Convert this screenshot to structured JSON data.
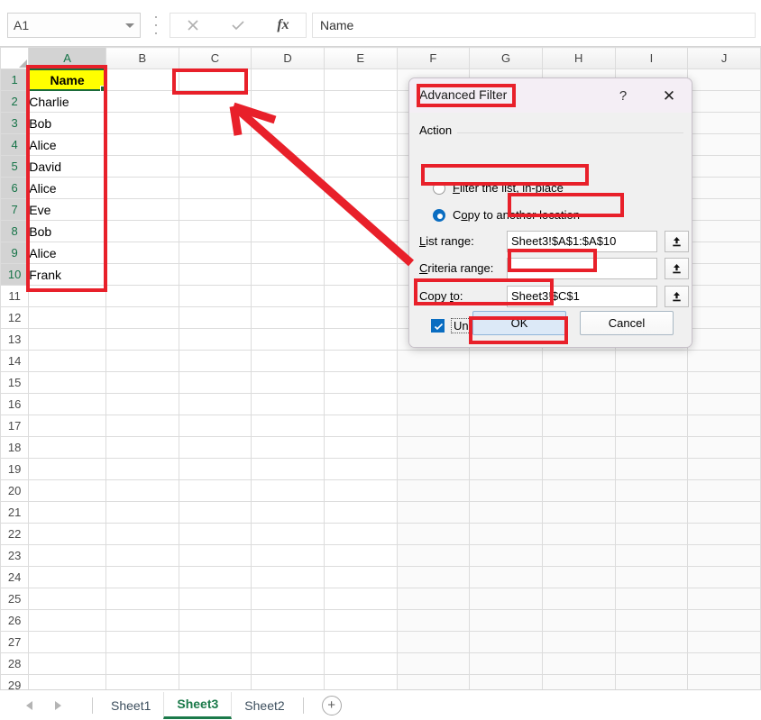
{
  "formula_bar": {
    "name_box_value": "A1",
    "formula_value": "Name",
    "cancel_icon": "close-icon",
    "confirm_icon": "check-icon",
    "function_icon": "fx-icon"
  },
  "grid": {
    "columns": [
      "A",
      "B",
      "C",
      "D",
      "E",
      "F",
      "G",
      "H",
      "I",
      "J"
    ],
    "rows": [
      1,
      2,
      3,
      4,
      5,
      6,
      7,
      8,
      9,
      10,
      11,
      12,
      13,
      14,
      15,
      16,
      17,
      18,
      19,
      20,
      21,
      22,
      23,
      24,
      25,
      26,
      27,
      28,
      29
    ],
    "column_a_values": [
      "Name",
      "Charlie",
      "Bob",
      "Alice",
      "David",
      "Alice",
      "Eve",
      "Bob",
      "Alice",
      "Frank"
    ],
    "selected_column": "A",
    "active_cell": "A1",
    "header_fill": "#ffff00"
  },
  "dialog": {
    "title": "Advanced Filter",
    "help_label": "?",
    "close_label": "✕",
    "action_group_label": "Action",
    "radio_inplace_label": "Filter the list, in-place",
    "radio_copy_label": "Copy to another location",
    "radio_selected": "copy",
    "list_range_label": "List range:",
    "list_range_value": "Sheet3!$A$1:$A$10",
    "criteria_range_label": "Criteria range:",
    "criteria_range_value": "",
    "copy_to_label": "Copy to:",
    "copy_to_value": "Sheet3!$C$1",
    "unique_label": "Unique records only",
    "unique_checked": true,
    "ok_label": "OK",
    "cancel_label": "Cancel",
    "range_picker_icon": "collapse-dialog-icon"
  },
  "sheet_tabs": {
    "prev_icon": "prev-sheet-icon",
    "next_icon": "next-sheet-icon",
    "tabs": [
      {
        "label": "Sheet1",
        "active": false
      },
      {
        "label": "Sheet3",
        "active": true
      },
      {
        "label": "Sheet2",
        "active": false
      }
    ],
    "add_label": "+",
    "add_icon": "add-sheet-icon"
  },
  "annotations": {
    "color": "#e8202a",
    "boxes": [
      "column-a-data-range",
      "cell-c1-destination",
      "dialog-title",
      "copy-to-another-location-radio",
      "list-range-input",
      "copy-to-input",
      "unique-records-only-checkbox",
      "ok-button"
    ],
    "arrow": "arrow-from-copy-to-field-to-cell-c1"
  }
}
